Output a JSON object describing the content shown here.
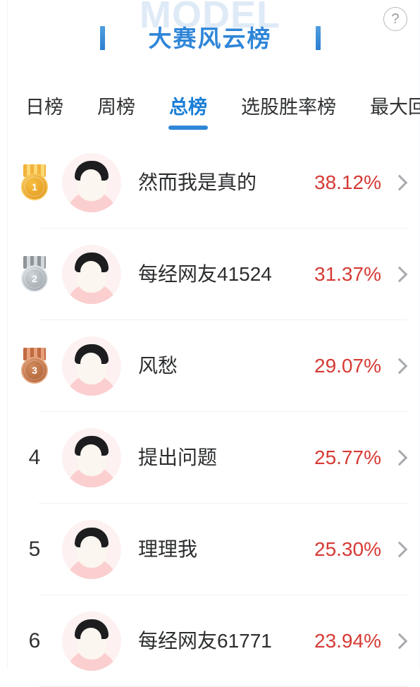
{
  "header": {
    "watermark": "MODEL",
    "title": "大赛风云榜",
    "help_icon_label": "?"
  },
  "tabs": [
    {
      "label": "日榜",
      "active": false
    },
    {
      "label": "周榜",
      "active": false
    },
    {
      "label": "总榜",
      "active": true
    },
    {
      "label": "选股胜率榜",
      "active": false
    },
    {
      "label": "最大回",
      "active": false
    }
  ],
  "colors": {
    "title_blue": "#2f86d8",
    "active_tab_blue": "#1a7ed6",
    "percent_red": "#d63a34",
    "watermark_blue": "#dfeaf7",
    "avatar_bg": "#fdf1f1",
    "avatar_shirt": "#fbcfcf"
  },
  "ranking": [
    {
      "rank": "1",
      "medal": "gold",
      "name": "然而我是真的",
      "percent": "38.12%"
    },
    {
      "rank": "2",
      "medal": "silver",
      "name": "每经网友41524",
      "percent": "31.37%"
    },
    {
      "rank": "3",
      "medal": "bronze",
      "name": "风愁",
      "percent": "29.07%"
    },
    {
      "rank": "4",
      "medal": "",
      "name": "提出问题",
      "percent": "25.77%"
    },
    {
      "rank": "5",
      "medal": "",
      "name": "理理我",
      "percent": "25.30%"
    },
    {
      "rank": "6",
      "medal": "",
      "name": "每经网友61771",
      "percent": "23.94%"
    }
  ]
}
